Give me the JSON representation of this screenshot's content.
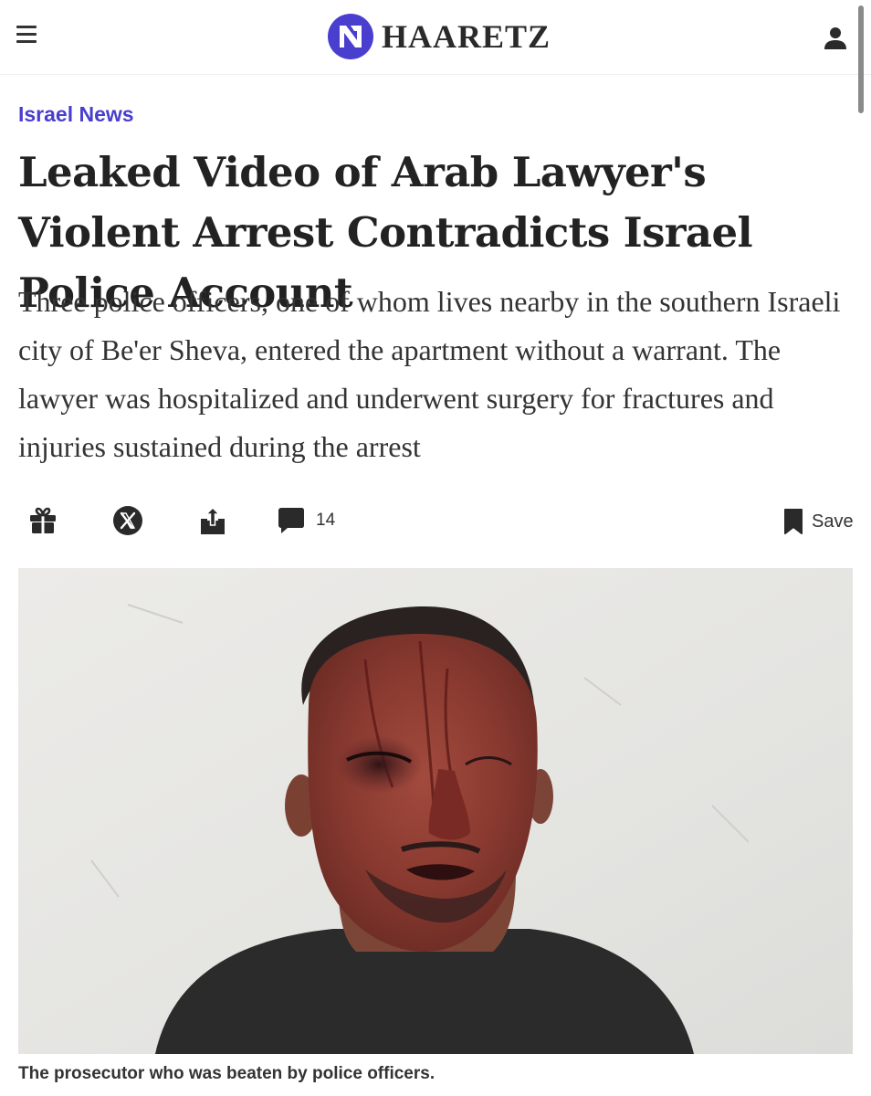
{
  "header": {
    "brand_name": "HAARETZ",
    "menu_icon": "hamburger-menu-icon",
    "account_icon": "user-icon",
    "brand_color": "#4a3ecf"
  },
  "article": {
    "category": "Israel News",
    "headline": "Leaked Video of Arab Lawyer's Violent Arrest Contradicts Israel Police Account",
    "dek": "Three police officers, one of whom lives nearby in the southern Israeli city of Be'er Sheva, entered the apartment without a warrant. The lawyer was hospitalized and underwent surgery for fractures and injuries sustained during the arrest",
    "photo_caption": "The prosecutor who was beaten by police officers."
  },
  "share_bar": {
    "gift_icon": "gift-icon",
    "x_icon": "x-logo-icon",
    "share_icon": "share-icon",
    "comment_icon": "comment-icon",
    "comment_count": "14",
    "save_icon": "bookmark-icon",
    "save_label": "Save"
  }
}
